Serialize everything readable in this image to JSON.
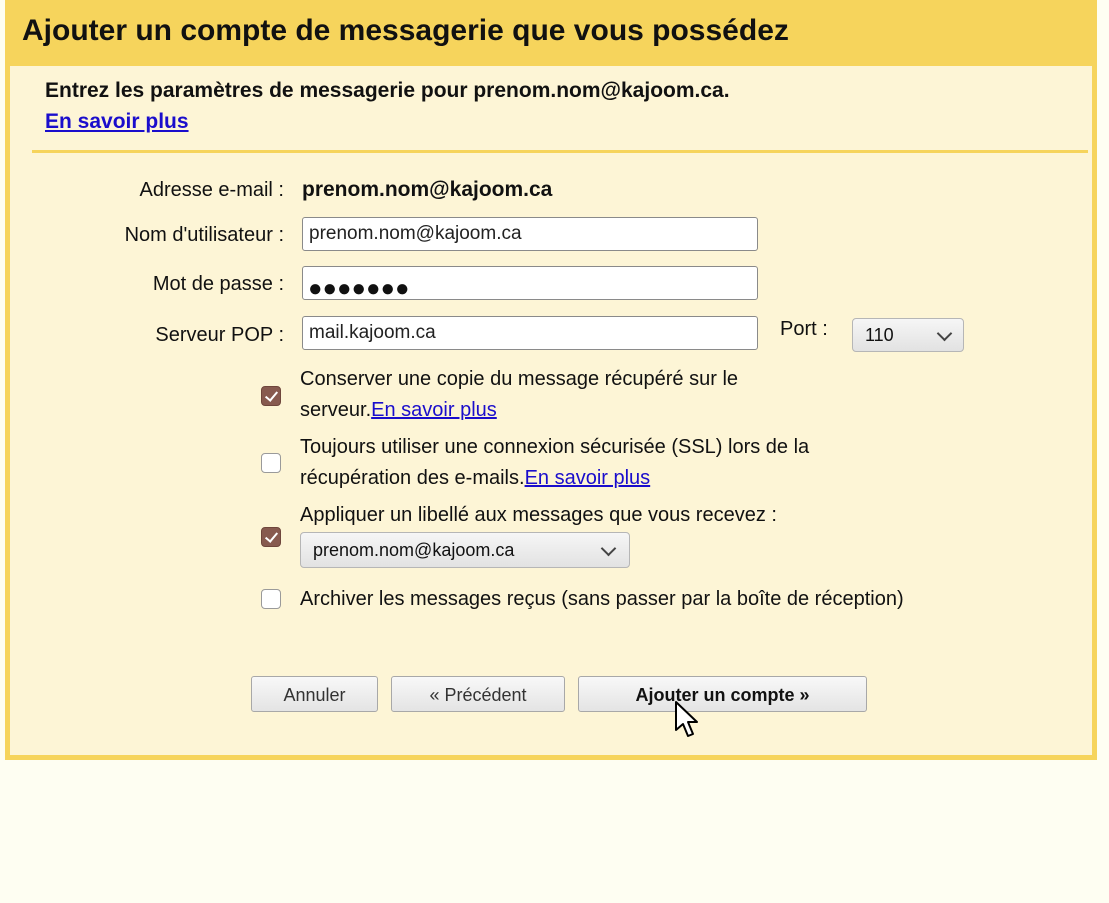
{
  "dialog": {
    "title": "Ajouter un compte de messagerie que vous possédez",
    "intro": "Entrez les paramètres de messagerie pour prenom.nom@kajoom.ca.",
    "intro_link": "En savoir plus"
  },
  "form": {
    "email": {
      "label": "Adresse e-mail :",
      "value": "prenom.nom@kajoom.ca"
    },
    "username": {
      "label": "Nom d'utilisateur :",
      "value": "prenom.nom@kajoom.ca"
    },
    "password": {
      "label": "Mot de passe :",
      "masked": "●●●●●●●"
    },
    "pop_server": {
      "label": "Serveur POP :",
      "value": "mail.kajoom.ca"
    },
    "port": {
      "label": "Port :",
      "value": "110"
    }
  },
  "options": [
    {
      "checked": true,
      "line1": "Conserver une copie du message récupéré sur le",
      "line2": "serveur.",
      "link": "En savoir plus"
    },
    {
      "checked": false,
      "line1": "Toujours utiliser une connexion sécurisée (SSL) lors de la",
      "line2": "récupération des e-mails.",
      "link": "En savoir plus"
    },
    {
      "checked": true,
      "line1": "Appliquer un libellé aux messages que vous recevez :",
      "select_value": "prenom.nom@kajoom.ca"
    },
    {
      "checked": false,
      "line1": "Archiver les messages reçus (sans passer par la boîte de réception)"
    }
  ],
  "buttons": {
    "cancel": "Annuler",
    "previous": "« Précédent",
    "add_account": "Ajouter un compte »"
  },
  "colors": {
    "title_bar": "#f6d45c",
    "panel_bg": "#fdf5d6",
    "link": "#1a0dcc",
    "checkbox_checked": "#875a4f"
  }
}
